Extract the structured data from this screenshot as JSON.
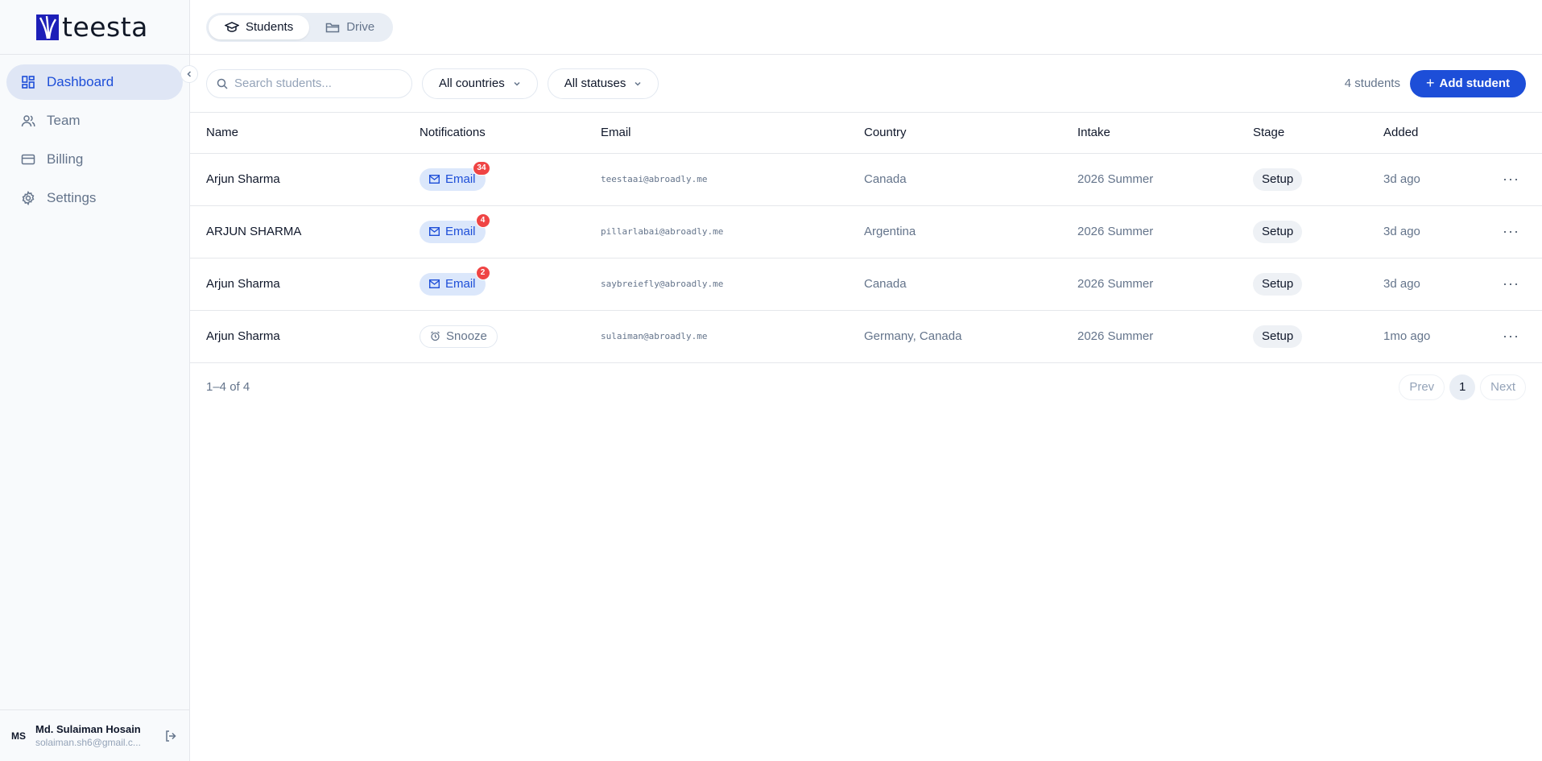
{
  "brand": {
    "name": "teesta",
    "accent": "#1d4ed8"
  },
  "sidebar": {
    "items": [
      {
        "label": "Dashboard",
        "icon": "dashboard-icon",
        "active": true
      },
      {
        "label": "Team",
        "icon": "team-icon",
        "active": false
      },
      {
        "label": "Billing",
        "icon": "billing-icon",
        "active": false
      },
      {
        "label": "Settings",
        "icon": "gear-icon",
        "active": false
      }
    ],
    "collapse_icon": "chevron-left-icon",
    "user": {
      "initials": "MS",
      "name": "Md. Sulaiman Hosain",
      "email": "solaiman.sh6@gmail.c..."
    }
  },
  "topbar": {
    "tabs": [
      {
        "label": "Students",
        "icon": "graduation-cap-icon",
        "active": true
      },
      {
        "label": "Drive",
        "icon": "folder-icon",
        "active": false
      }
    ]
  },
  "toolbar": {
    "search_placeholder": "Search students...",
    "country_filter": "All countries",
    "status_filter": "All statuses",
    "count": "4 students",
    "add_label": "Add student"
  },
  "table": {
    "headers": [
      "Name",
      "Notifications",
      "Email",
      "Country",
      "Intake",
      "Stage",
      "Added"
    ],
    "rows": [
      {
        "name": "Arjun Sharma",
        "notif_label": "Email",
        "notif_count": "34",
        "email": "teestaai@abroadly.me",
        "country": "Canada",
        "intake": "2026 Summer",
        "stage": "Setup",
        "added": "3d ago"
      },
      {
        "name": "ARJUN SHARMA",
        "notif_label": "Email",
        "notif_count": "4",
        "email": "pillarlabai@abroadly.me",
        "country": "Argentina",
        "intake": "2026 Summer",
        "stage": "Setup",
        "added": "3d ago"
      },
      {
        "name": "Arjun Sharma",
        "notif_label": "Email",
        "notif_count": "2",
        "email": "saybreiefly@abroadly.me",
        "country": "Canada",
        "intake": "2026 Summer",
        "stage": "Setup",
        "added": "3d ago"
      },
      {
        "name": "Arjun Sharma",
        "notif_label": "Snooze",
        "notif_count": "",
        "email": "sulaiman@abroadly.me",
        "country": "Germany, Canada",
        "intake": "2026 Summer",
        "stage": "Setup",
        "added": "1mo ago"
      }
    ],
    "more_label": "···"
  },
  "pagination": {
    "range": "1–4 of 4",
    "prev": "Prev",
    "page": "1",
    "next": "Next"
  }
}
